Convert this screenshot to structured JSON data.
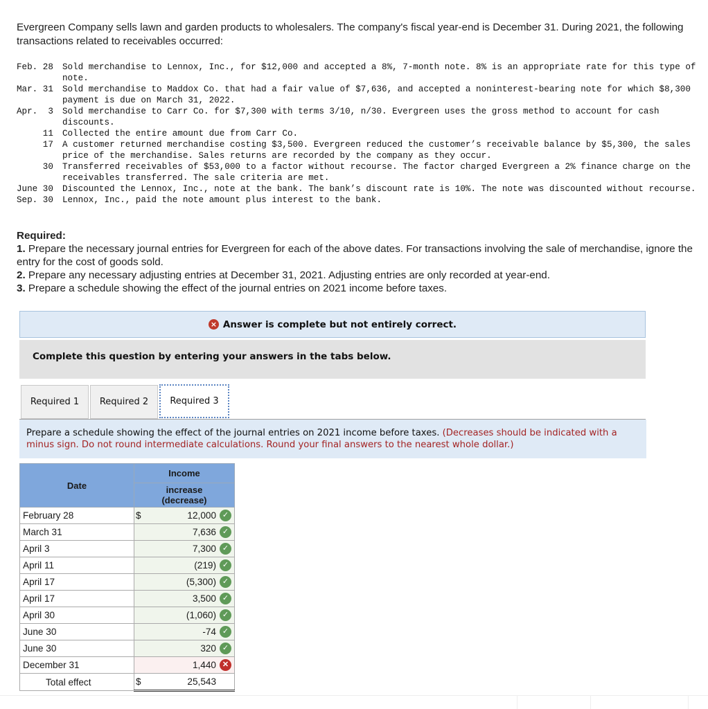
{
  "intro": "Evergreen Company sells lawn and garden products to wholesalers. The company's fiscal year-end is December 31. During 2021, the following transactions related to receivables occurred:",
  "transactions": [
    {
      "date": "Feb. 28",
      "text": "Sold merchandise to Lennox, Inc., for $12,000 and accepted a 8%, 7-month note. 8% is an appropriate rate for this type of note."
    },
    {
      "date": "Mar. 31",
      "text": "Sold merchandise to Maddox Co. that had a fair value of $7,636, and accepted a noninterest-bearing note for which $8,300 payment is due on March 31, 2022."
    },
    {
      "date": "Apr.  3",
      "text": "Sold merchandise to Carr Co. for $7,300 with terms 3/10, n/30. Evergreen uses the gross method to account for cash discounts."
    },
    {
      "date": "     11",
      "text": "Collected the entire amount due from Carr Co."
    },
    {
      "date": "     17",
      "text": "A customer returned merchandise costing $3,500. Evergreen reduced the customer’s receivable balance by $5,300, the sales price of the merchandise. Sales returns are recorded by the company as they occur."
    },
    {
      "date": "     30",
      "text": "Transferred receivables of $53,000 to a factor without recourse. The factor charged Evergreen a 2% finance charge on the receivables transferred. The sale criteria are met."
    },
    {
      "date": "June 30",
      "text": "Discounted the Lennox, Inc., note at the bank. The bank’s discount rate is 10%. The note was discounted without recourse."
    },
    {
      "date": "Sep. 30",
      "text": "Lennox, Inc., paid the note amount plus interest to the bank."
    }
  ],
  "required": {
    "heading": "Required:",
    "items": [
      {
        "num": "1.",
        "text": " Prepare the necessary journal entries for Evergreen for each of the above dates. For transactions involving the sale of merchandise, ignore the entry for the cost of goods sold."
      },
      {
        "num": "2.",
        "text": " Prepare any necessary adjusting entries at December 31, 2021. Adjusting entries are only recorded at year-end."
      },
      {
        "num": "3.",
        "text": " Prepare a schedule showing the effect of the journal entries on 2021 income before taxes."
      }
    ]
  },
  "result_banner": {
    "icon": "error-icon",
    "text": "Answer is complete but not entirely correct."
  },
  "instruction": "Complete this question by entering your answers in the tabs below.",
  "tabs": [
    {
      "label": "Required 1",
      "active": false
    },
    {
      "label": "Required 2",
      "active": false
    },
    {
      "label": "Required 3",
      "active": true
    }
  ],
  "prompt": {
    "text": "Prepare a schedule showing the effect of the journal entries on 2021 income before taxes. ",
    "note": "(Decreases should be indicated with a minus sign. Do not round intermediate calculations. Round your final answers to the nearest whole dollar.)"
  },
  "schedule": {
    "headers": {
      "date": "Date",
      "income_line1": "Income",
      "income_line2": "increase",
      "income_line3": "(decrease)"
    },
    "currency": "$",
    "rows": [
      {
        "date": "February 28",
        "value": "12,000",
        "status": "correct",
        "show_currency": true
      },
      {
        "date": "March 31",
        "value": "7,636",
        "status": "correct"
      },
      {
        "date": "April 3",
        "value": "7,300",
        "status": "correct"
      },
      {
        "date": "April 11",
        "value": "(219)",
        "status": "correct"
      },
      {
        "date": "April 17",
        "value": "(5,300)",
        "status": "correct"
      },
      {
        "date": "April 17",
        "value": "3,500",
        "status": "correct"
      },
      {
        "date": "April 30",
        "value": "(1,060)",
        "status": "correct"
      },
      {
        "date": "June 30",
        "value": "-74",
        "status": "correct"
      },
      {
        "date": "June 30",
        "value": "320",
        "status": "correct"
      },
      {
        "date": "December 31",
        "value": "1,440",
        "status": "incorrect"
      }
    ],
    "total": {
      "label": "Total effect",
      "value": "25,543"
    },
    "status_icons": {
      "correct": "✓",
      "incorrect": "✕"
    }
  },
  "colors": {
    "banner_bg": "#dfeaf6",
    "header_bg": "#7fa7dc",
    "correct": "#5f9a58",
    "incorrect": "#c0302b",
    "note_red": "#a32424"
  }
}
